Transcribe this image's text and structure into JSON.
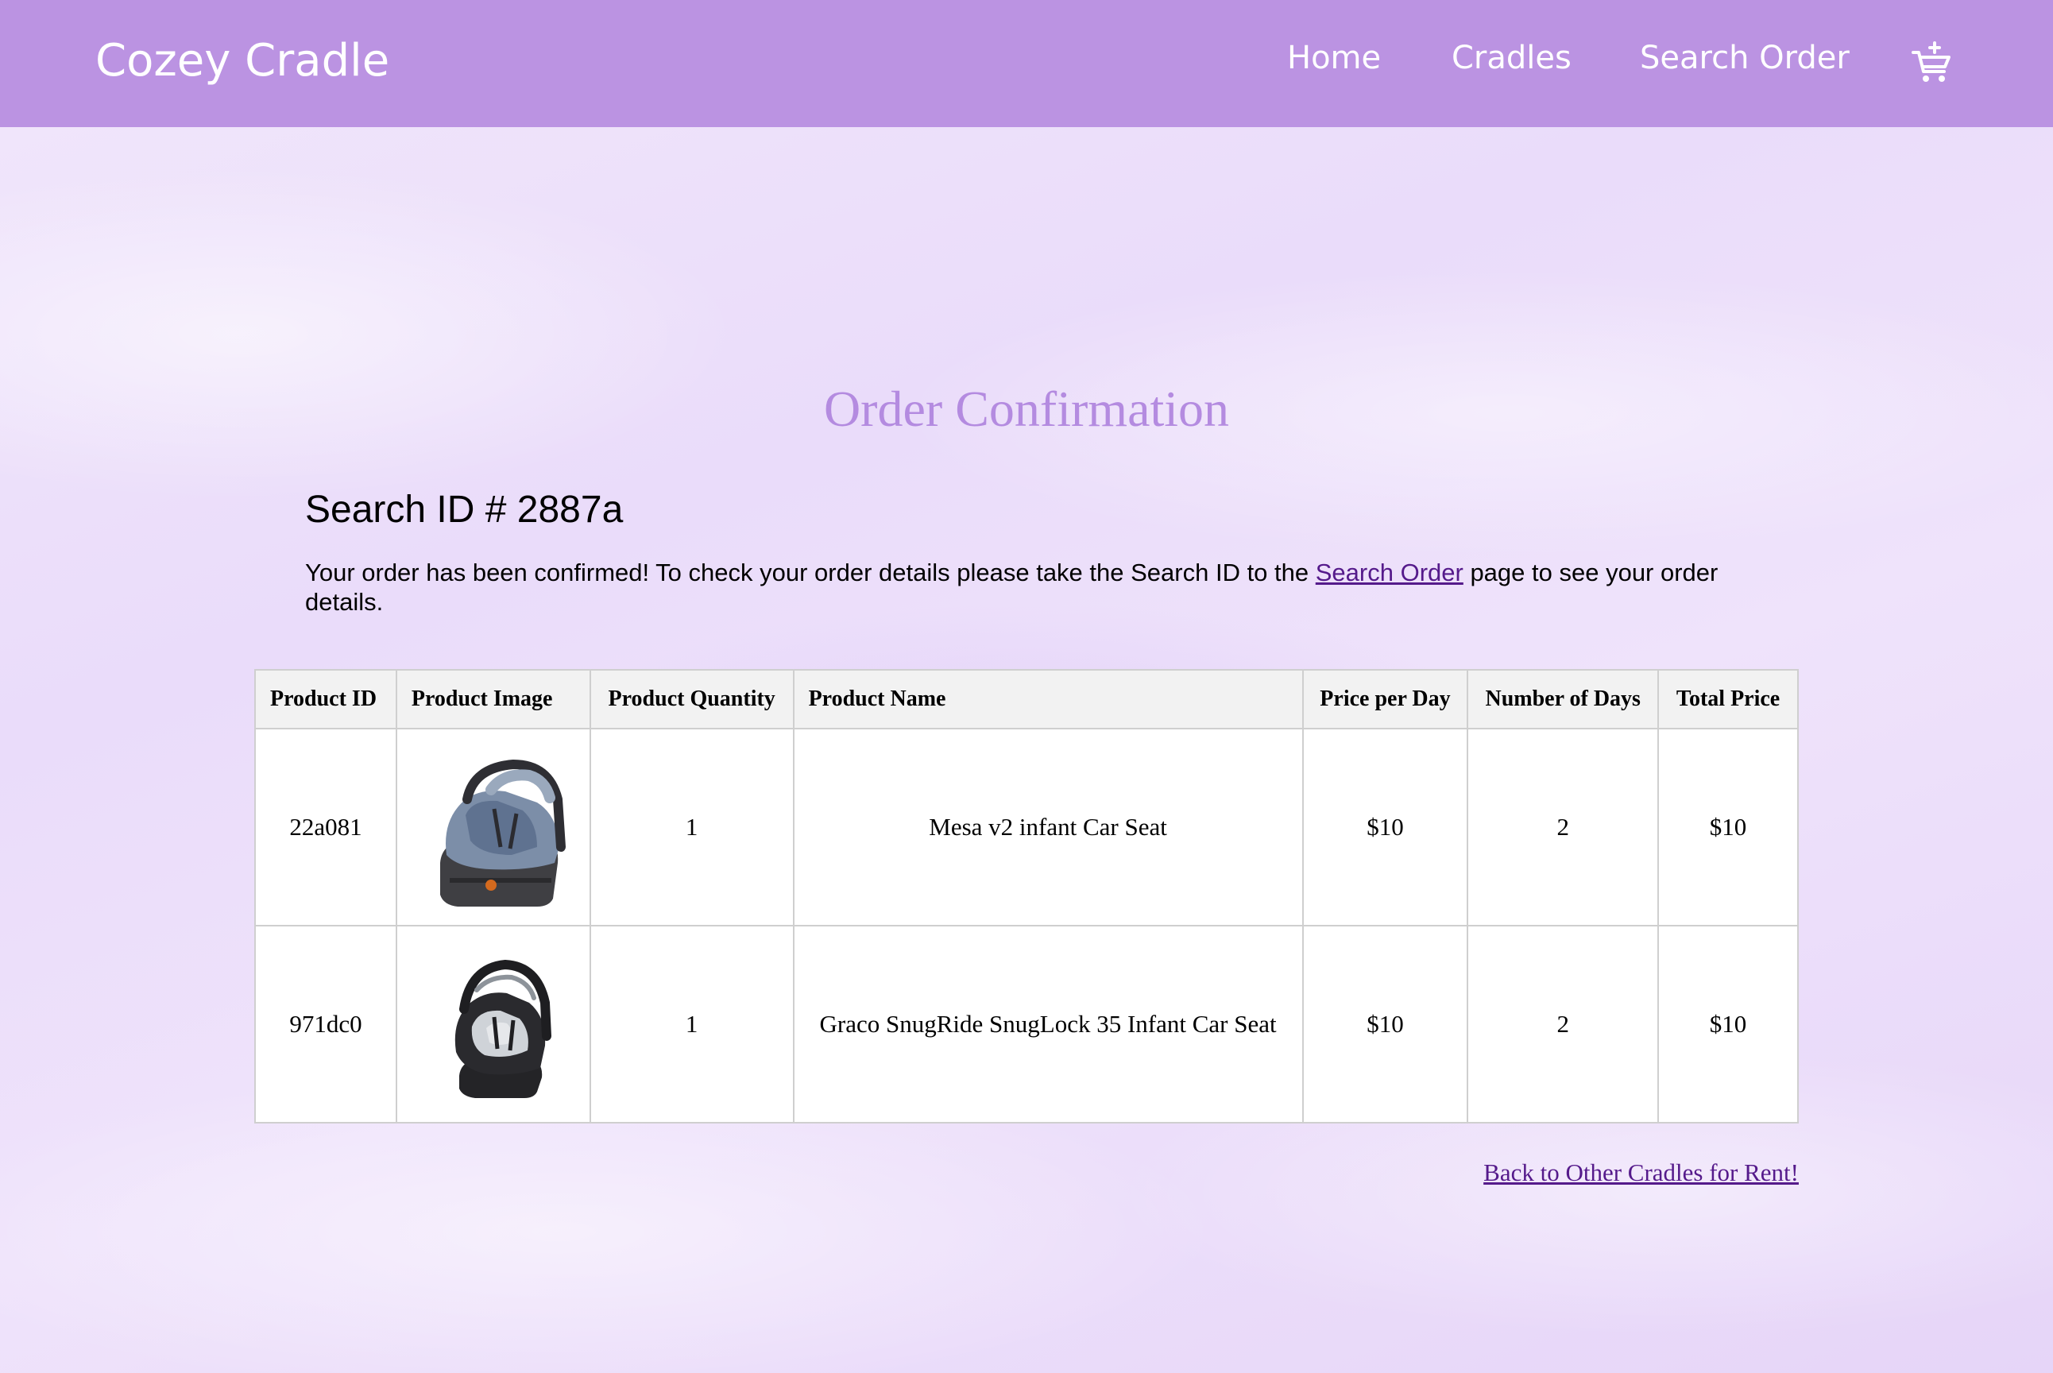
{
  "header": {
    "brand": "Cozey Cradle",
    "nav": [
      "Home",
      "Cradles",
      "Search Order"
    ],
    "cart_icon": "cart-plus-icon",
    "background_color": "#bb93e2",
    "text_color": "#ffffff"
  },
  "main": {
    "title": "Order Confirmation",
    "title_color": "#b48be0",
    "search_id": "Search ID # 2887a",
    "message_before": "Your order has been confirmed! To check your order details please take the Search ID to the ",
    "message_link": "Search Order",
    "message_after": " page to see your order details.",
    "link_color": "#551a8b"
  },
  "table": {
    "headers": [
      "Product ID",
      "Product Image",
      "Product Quantity",
      "Product Name",
      "Price per Day",
      "Number of Days",
      "Total Price"
    ],
    "rows": [
      {
        "product_id": "22a081",
        "image": "infant-car-seat-gray-image",
        "quantity": "1",
        "name": "Mesa v2 infant Car Seat",
        "price_per_day": "$10",
        "days": "2",
        "total": "$10"
      },
      {
        "product_id": "971dc0",
        "image": "infant-car-seat-black-image",
        "quantity": "1",
        "name": "Graco SnugRide SnugLock 35 Infant Car Seat",
        "price_per_day": "$10",
        "days": "2",
        "total": "$10"
      }
    ]
  },
  "footer": {
    "back_link": "Back to Other Cradles for Rent!"
  }
}
